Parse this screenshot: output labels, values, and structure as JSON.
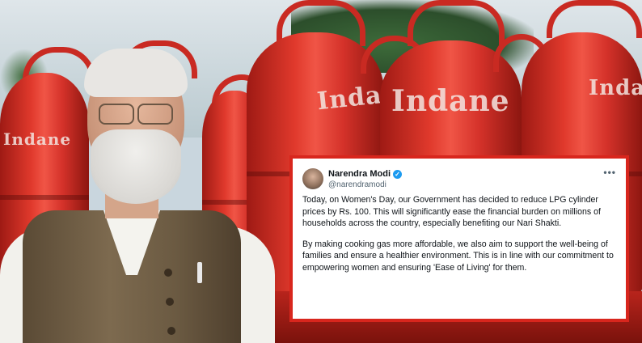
{
  "background": {
    "cylinder_brand_label": "Indane"
  },
  "tweet": {
    "author_name": "Narendra Modi",
    "author_handle": "@narendramodi",
    "verified_mark": "✓",
    "more_menu": "•••",
    "paragraphs": [
      "Today, on Women's Day, our Government has decided to reduce LPG cylinder prices by Rs. 100. This will significantly ease the financial burden on millions of households across the country, especially benefiting our Nari Shakti.",
      "By making cooking gas more affordable, we also aim to support the well-being of families and ensure a healthier environment. This is in line with our commitment to empowering women and ensuring 'Ease of Living' for them."
    ]
  },
  "colors": {
    "frame_red": "#d8261d",
    "verified_blue": "#1d9bf0",
    "cylinder_red": "#e0392c"
  }
}
